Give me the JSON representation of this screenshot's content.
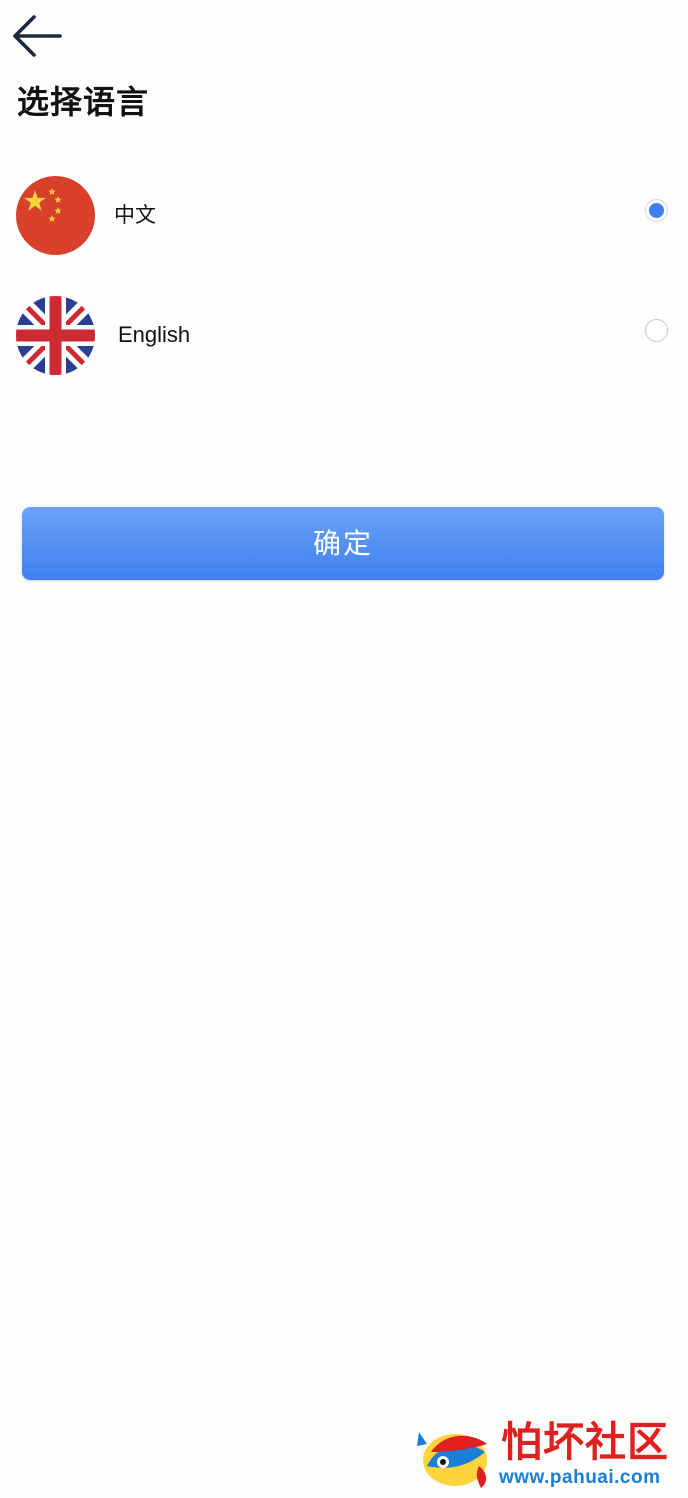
{
  "header": {
    "back_icon": "arrow-left-icon",
    "title": "选择语言"
  },
  "languages": [
    {
      "label": "中文",
      "flag": "china-flag-icon",
      "selected": true
    },
    {
      "label": "English",
      "flag": "uk-flag-icon",
      "selected": false
    }
  ],
  "confirm": {
    "label": "确定"
  },
  "watermark": {
    "title": "怕坏社区",
    "url": "www.pahuai.com"
  },
  "colors": {
    "accent": "#3f7ff0",
    "button_top": "#6aa2f7",
    "button_bottom": "#3f80f0",
    "radio_border": "#c9c9c9",
    "china_red": "#d8402b",
    "china_star": "#f6d33c",
    "uk_blue": "#2a3f93",
    "uk_red": "#cf2a32",
    "watermark_red": "#e0201e",
    "watermark_blue": "#1a7fd8"
  }
}
